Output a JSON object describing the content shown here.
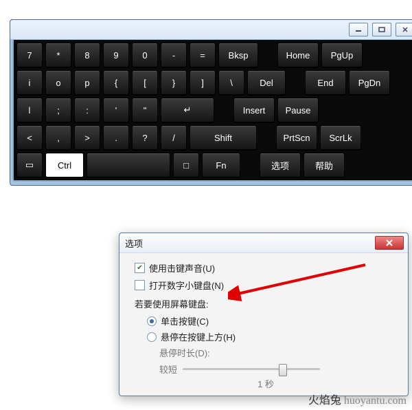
{
  "osk": {
    "rows": [
      [
        {
          "l": "7",
          "w": "w1"
        },
        {
          "l": "*",
          "w": "w1"
        },
        {
          "l": "8",
          "w": "w1"
        },
        {
          "l": "9",
          "w": "w1"
        },
        {
          "l": "0",
          "w": "w1"
        },
        {
          "l": "-",
          "w": "w1"
        },
        {
          "l": "=",
          "w": "w1"
        },
        {
          "l": "Bksp",
          "w": "bksp"
        },
        {
          "gap": true
        },
        {
          "l": "Home",
          "w": "fn1"
        },
        {
          "l": "PgUp",
          "w": "fn2"
        }
      ],
      [
        {
          "l": "i",
          "w": "w1"
        },
        {
          "l": "o",
          "w": "w1"
        },
        {
          "l": "p",
          "w": "w1"
        },
        {
          "l": "{",
          "w": "w1"
        },
        {
          "l": "[",
          "w": "w1"
        },
        {
          "l": "}",
          "w": "w1"
        },
        {
          "l": "]",
          "w": "w1"
        },
        {
          "l": "\\",
          "w": "w1"
        },
        {
          "l": "Del",
          "w": "w15"
        },
        {
          "gap": true
        },
        {
          "l": "End",
          "w": "fn1"
        },
        {
          "l": "PgDn",
          "w": "fn2"
        }
      ],
      [
        {
          "l": "l",
          "w": "w1"
        },
        {
          "l": ";",
          "w": "w1"
        },
        {
          "l": ":",
          "w": "w1"
        },
        {
          "l": "'",
          "w": "w1"
        },
        {
          "l": "\"",
          "w": "w1"
        },
        {
          "l": "↵",
          "w": "enter"
        },
        {
          "gap": true
        },
        {
          "l": "Insert",
          "w": "fn1"
        },
        {
          "l": "Pause",
          "w": "fn2"
        }
      ],
      [
        {
          "l": "<",
          "w": "w1"
        },
        {
          "l": ",",
          "w": "w1"
        },
        {
          "l": ">",
          "w": "w1"
        },
        {
          "l": ".",
          "w": "w1"
        },
        {
          "l": "?",
          "w": "w1"
        },
        {
          "l": "/",
          "w": "w1"
        },
        {
          "l": "Shift",
          "w": "shift"
        },
        {
          "gap": true
        },
        {
          "l": "PrtScn",
          "w": "fn1"
        },
        {
          "l": "ScrLk",
          "w": "fn2"
        }
      ],
      [
        {
          "l": "▭",
          "w": "sys"
        },
        {
          "l": "Ctrl",
          "w": "w15",
          "pressed": true
        },
        {
          "l": "",
          "w": "w3",
          "space": true
        },
        {
          "l": "□",
          "w": "app"
        },
        {
          "l": "Fn",
          "w": "w15"
        },
        {
          "gap": true
        },
        {
          "l": "选项",
          "w": "fn1"
        },
        {
          "l": "帮助",
          "w": "fn2"
        }
      ]
    ]
  },
  "dialog": {
    "title": "选项",
    "opt_sound": "使用击键声音(U)",
    "opt_numpad": "打开数字小键盘(N)",
    "legend": "若要使用屏幕键盘:",
    "radio_click": "单击按键(C)",
    "radio_hover": "悬停在按键上方(H)",
    "hover_duration_label": "悬停时长(D):",
    "hover_short": "较短",
    "hover_value": "1 秒"
  },
  "watermark": {
    "cn": "火焰兔",
    "en": " huoyantu.com"
  }
}
